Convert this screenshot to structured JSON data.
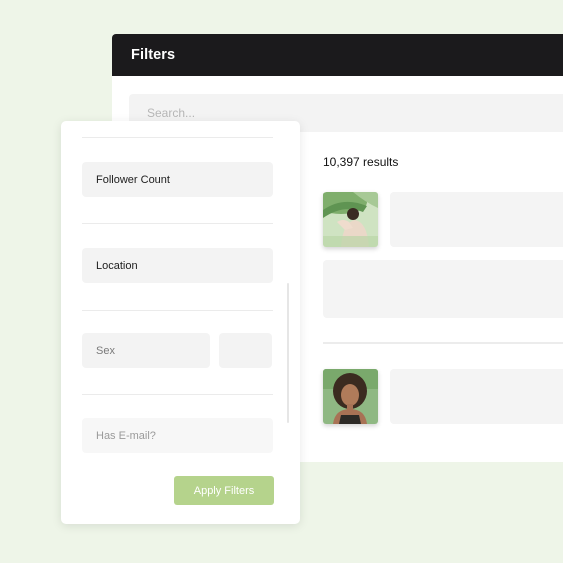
{
  "window": {
    "title": "Filters",
    "search_placeholder": "Search..."
  },
  "results": {
    "count_label": "10,397 results"
  },
  "filters": {
    "fields": [
      {
        "label": "Follower Count"
      },
      {
        "label": "Location"
      },
      {
        "label": "Sex"
      },
      {
        "label": "Has E-mail?"
      }
    ],
    "apply_label": "Apply Filters"
  },
  "colors": {
    "background": "#eef5e8",
    "titlebar": "#1b1a1c",
    "apply_button": "#b5d38c"
  }
}
